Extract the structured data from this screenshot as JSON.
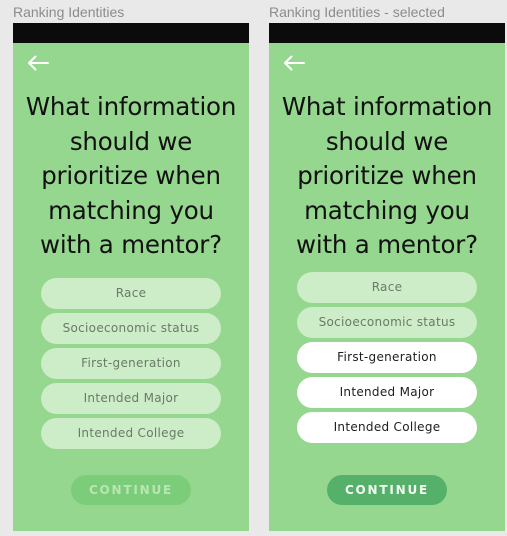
{
  "frames": [
    {
      "label": "Ranking Identities",
      "question": [
        "What information",
        "should we",
        "prioritize when",
        "matching you",
        "with a mentor?"
      ],
      "options": [
        {
          "label": "Race",
          "selected": false
        },
        {
          "label": "Socioeconomic status",
          "selected": false
        },
        {
          "label": "First-generation",
          "selected": false
        },
        {
          "label": "Intended Major",
          "selected": false
        },
        {
          "label": "Intended College",
          "selected": false
        }
      ],
      "continue_label": "CONTINUE",
      "continue_enabled": false
    },
    {
      "label": "Ranking Identities - selected",
      "question": [
        "What information",
        "should we",
        "prioritize when",
        "matching you",
        "with a mentor?"
      ],
      "options": [
        {
          "label": "Race",
          "selected": false
        },
        {
          "label": "Socioeconomic status",
          "selected": false
        },
        {
          "label": "First-generation",
          "selected": true
        },
        {
          "label": "Intended Major",
          "selected": true
        },
        {
          "label": "Intended College",
          "selected": true
        }
      ],
      "continue_label": "CONTINUE",
      "continue_enabled": true
    }
  ],
  "icons": {
    "back": "arrow-left-icon"
  },
  "colors": {
    "screen_background": "#95d78e",
    "status_bar": "#0b0b0b",
    "option_unselected": "#cdecc8",
    "option_selected": "#ffffff",
    "continue_inactive": "#7ccd7a",
    "continue_active": "#55b06a"
  }
}
